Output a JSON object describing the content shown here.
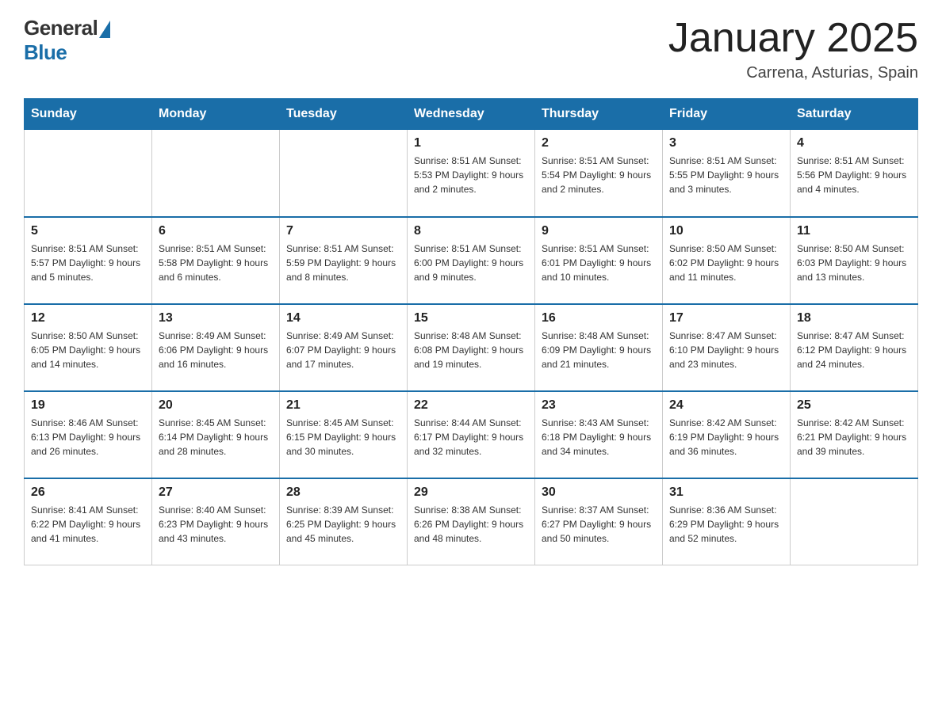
{
  "header": {
    "logo_general": "General",
    "logo_blue": "Blue",
    "title": "January 2025",
    "subtitle": "Carrena, Asturias, Spain"
  },
  "days_of_week": [
    "Sunday",
    "Monday",
    "Tuesday",
    "Wednesday",
    "Thursday",
    "Friday",
    "Saturday"
  ],
  "weeks": [
    [
      {
        "day": "",
        "info": ""
      },
      {
        "day": "",
        "info": ""
      },
      {
        "day": "",
        "info": ""
      },
      {
        "day": "1",
        "info": "Sunrise: 8:51 AM\nSunset: 5:53 PM\nDaylight: 9 hours and 2 minutes."
      },
      {
        "day": "2",
        "info": "Sunrise: 8:51 AM\nSunset: 5:54 PM\nDaylight: 9 hours and 2 minutes."
      },
      {
        "day": "3",
        "info": "Sunrise: 8:51 AM\nSunset: 5:55 PM\nDaylight: 9 hours and 3 minutes."
      },
      {
        "day": "4",
        "info": "Sunrise: 8:51 AM\nSunset: 5:56 PM\nDaylight: 9 hours and 4 minutes."
      }
    ],
    [
      {
        "day": "5",
        "info": "Sunrise: 8:51 AM\nSunset: 5:57 PM\nDaylight: 9 hours and 5 minutes."
      },
      {
        "day": "6",
        "info": "Sunrise: 8:51 AM\nSunset: 5:58 PM\nDaylight: 9 hours and 6 minutes."
      },
      {
        "day": "7",
        "info": "Sunrise: 8:51 AM\nSunset: 5:59 PM\nDaylight: 9 hours and 8 minutes."
      },
      {
        "day": "8",
        "info": "Sunrise: 8:51 AM\nSunset: 6:00 PM\nDaylight: 9 hours and 9 minutes."
      },
      {
        "day": "9",
        "info": "Sunrise: 8:51 AM\nSunset: 6:01 PM\nDaylight: 9 hours and 10 minutes."
      },
      {
        "day": "10",
        "info": "Sunrise: 8:50 AM\nSunset: 6:02 PM\nDaylight: 9 hours and 11 minutes."
      },
      {
        "day": "11",
        "info": "Sunrise: 8:50 AM\nSunset: 6:03 PM\nDaylight: 9 hours and 13 minutes."
      }
    ],
    [
      {
        "day": "12",
        "info": "Sunrise: 8:50 AM\nSunset: 6:05 PM\nDaylight: 9 hours and 14 minutes."
      },
      {
        "day": "13",
        "info": "Sunrise: 8:49 AM\nSunset: 6:06 PM\nDaylight: 9 hours and 16 minutes."
      },
      {
        "day": "14",
        "info": "Sunrise: 8:49 AM\nSunset: 6:07 PM\nDaylight: 9 hours and 17 minutes."
      },
      {
        "day": "15",
        "info": "Sunrise: 8:48 AM\nSunset: 6:08 PM\nDaylight: 9 hours and 19 minutes."
      },
      {
        "day": "16",
        "info": "Sunrise: 8:48 AM\nSunset: 6:09 PM\nDaylight: 9 hours and 21 minutes."
      },
      {
        "day": "17",
        "info": "Sunrise: 8:47 AM\nSunset: 6:10 PM\nDaylight: 9 hours and 23 minutes."
      },
      {
        "day": "18",
        "info": "Sunrise: 8:47 AM\nSunset: 6:12 PM\nDaylight: 9 hours and 24 minutes."
      }
    ],
    [
      {
        "day": "19",
        "info": "Sunrise: 8:46 AM\nSunset: 6:13 PM\nDaylight: 9 hours and 26 minutes."
      },
      {
        "day": "20",
        "info": "Sunrise: 8:45 AM\nSunset: 6:14 PM\nDaylight: 9 hours and 28 minutes."
      },
      {
        "day": "21",
        "info": "Sunrise: 8:45 AM\nSunset: 6:15 PM\nDaylight: 9 hours and 30 minutes."
      },
      {
        "day": "22",
        "info": "Sunrise: 8:44 AM\nSunset: 6:17 PM\nDaylight: 9 hours and 32 minutes."
      },
      {
        "day": "23",
        "info": "Sunrise: 8:43 AM\nSunset: 6:18 PM\nDaylight: 9 hours and 34 minutes."
      },
      {
        "day": "24",
        "info": "Sunrise: 8:42 AM\nSunset: 6:19 PM\nDaylight: 9 hours and 36 minutes."
      },
      {
        "day": "25",
        "info": "Sunrise: 8:42 AM\nSunset: 6:21 PM\nDaylight: 9 hours and 39 minutes."
      }
    ],
    [
      {
        "day": "26",
        "info": "Sunrise: 8:41 AM\nSunset: 6:22 PM\nDaylight: 9 hours and 41 minutes."
      },
      {
        "day": "27",
        "info": "Sunrise: 8:40 AM\nSunset: 6:23 PM\nDaylight: 9 hours and 43 minutes."
      },
      {
        "day": "28",
        "info": "Sunrise: 8:39 AM\nSunset: 6:25 PM\nDaylight: 9 hours and 45 minutes."
      },
      {
        "day": "29",
        "info": "Sunrise: 8:38 AM\nSunset: 6:26 PM\nDaylight: 9 hours and 48 minutes."
      },
      {
        "day": "30",
        "info": "Sunrise: 8:37 AM\nSunset: 6:27 PM\nDaylight: 9 hours and 50 minutes."
      },
      {
        "day": "31",
        "info": "Sunrise: 8:36 AM\nSunset: 6:29 PM\nDaylight: 9 hours and 52 minutes."
      },
      {
        "day": "",
        "info": ""
      }
    ]
  ]
}
